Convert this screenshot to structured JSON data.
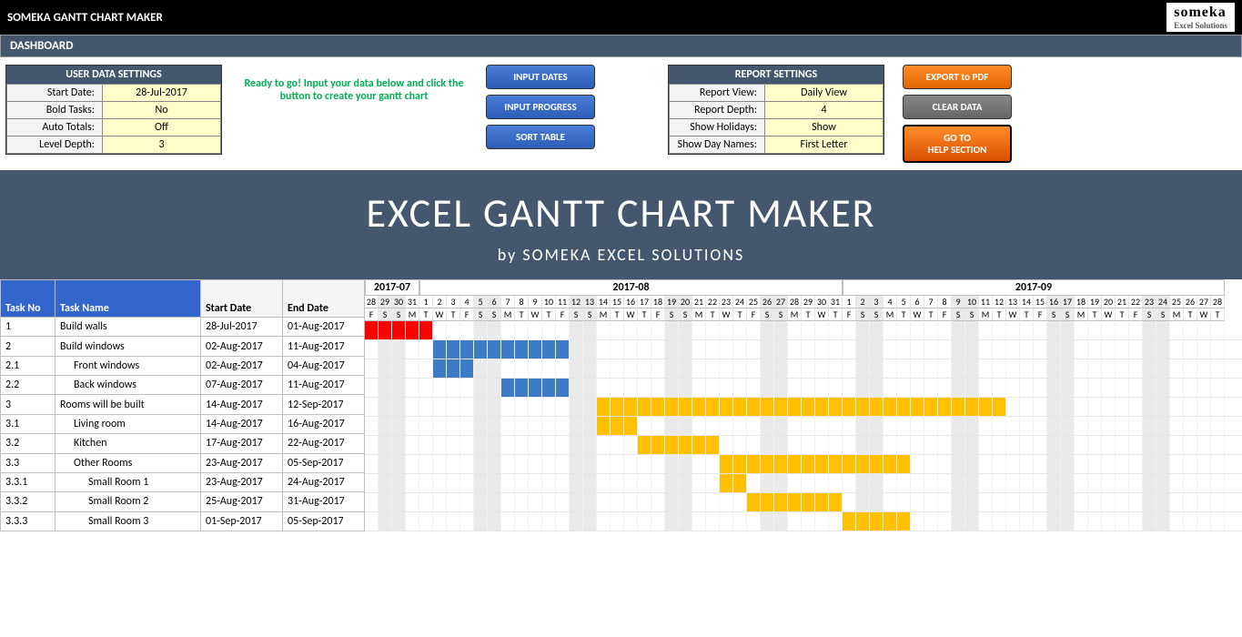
{
  "topbar": {
    "title": "SOMEKA GANTT CHART MAKER",
    "logo_main": "someka",
    "logo_sub": "Excel Solutions"
  },
  "dashboard": "DASHBOARD",
  "user_settings": {
    "header": "USER DATA SETTINGS",
    "rows": [
      {
        "label": "Start Date:",
        "value": "28-Jul-2017"
      },
      {
        "label": "Bold Tasks:",
        "value": "No"
      },
      {
        "label": "Auto Totals:",
        "value": "Off"
      },
      {
        "label": "Level Depth:",
        "value": "3"
      }
    ]
  },
  "ready_msg": "Ready to go! Input your data below and click the button to create your gantt chart",
  "action_buttons": [
    "INPUT DATES",
    "INPUT PROGRESS",
    "SORT TABLE"
  ],
  "report_settings": {
    "header": "REPORT SETTINGS",
    "rows": [
      {
        "label": "Report View:",
        "value": "Daily View"
      },
      {
        "label": "Report Depth:",
        "value": "4"
      },
      {
        "label": "Show Holidays:",
        "value": "Show"
      },
      {
        "label": "Show Day Names:",
        "value": "First Letter"
      }
    ]
  },
  "right_buttons": {
    "export": "EXPORT to PDF",
    "clear": "CLEAR DATA",
    "help1": "GO TO",
    "help2": "HELP SECTION"
  },
  "hero": {
    "title": "EXCEL GANTT CHART MAKER",
    "sub": "by SOMEKA EXCEL SOLUTIONS"
  },
  "table_headers": {
    "no": "Task No",
    "name": "Task Name",
    "start": "Start Date",
    "end": "End Date"
  },
  "months": [
    {
      "label": "2017-07",
      "days": 4
    },
    {
      "label": "2017-08",
      "days": 31
    },
    {
      "label": "2017-09",
      "days": 28
    }
  ],
  "timeline_start": "2017-07-28",
  "day_numbers": [
    28,
    29,
    30,
    31,
    1,
    2,
    3,
    4,
    5,
    6,
    7,
    8,
    9,
    10,
    11,
    12,
    13,
    14,
    15,
    16,
    17,
    18,
    19,
    20,
    21,
    22,
    23,
    24,
    25,
    26,
    27,
    28,
    29,
    30,
    31,
    1,
    2,
    3,
    4,
    5,
    6,
    7,
    8,
    9,
    10,
    11,
    12,
    13,
    14,
    15,
    16,
    17,
    18,
    19,
    20,
    21,
    22,
    23,
    24,
    25,
    26,
    27,
    28
  ],
  "day_names": [
    "F",
    "S",
    "S",
    "M",
    "T",
    "W",
    "T",
    "F",
    "S",
    "S",
    "M",
    "T",
    "W",
    "T",
    "F",
    "S",
    "S",
    "M",
    "T",
    "W",
    "T",
    "F",
    "S",
    "S",
    "M",
    "T",
    "W",
    "T",
    "F",
    "S",
    "S",
    "M",
    "T",
    "W",
    "T",
    "F",
    "S",
    "S",
    "M",
    "T",
    "W",
    "T",
    "F",
    "S",
    "S",
    "M",
    "T",
    "W",
    "T",
    "F",
    "S",
    "S",
    "M",
    "T",
    "W",
    "T",
    "F",
    "S",
    "S",
    "M",
    "T",
    "W",
    "T"
  ],
  "tasks": [
    {
      "no": "1",
      "name": "Build walls",
      "indent": 0,
      "start": "28-Jul-2017",
      "end": "01-Aug-2017",
      "bar_start": 0,
      "bar_len": 5,
      "color": "bar-red"
    },
    {
      "no": "2",
      "name": "Build windows",
      "indent": 0,
      "start": "02-Aug-2017",
      "end": "11-Aug-2017",
      "bar_start": 5,
      "bar_len": 10,
      "color": "bar-blue"
    },
    {
      "no": "2.1",
      "name": "Front windows",
      "indent": 1,
      "start": "02-Aug-2017",
      "end": "04-Aug-2017",
      "bar_start": 5,
      "bar_len": 3,
      "color": "bar-blue"
    },
    {
      "no": "2.2",
      "name": "Back windows",
      "indent": 1,
      "start": "07-Aug-2017",
      "end": "11-Aug-2017",
      "bar_start": 10,
      "bar_len": 5,
      "color": "bar-blue"
    },
    {
      "no": "3",
      "name": "Rooms will be built",
      "indent": 0,
      "start": "14-Aug-2017",
      "end": "12-Sep-2017",
      "bar_start": 17,
      "bar_len": 30,
      "color": "bar-yellow"
    },
    {
      "no": "3.1",
      "name": "Living room",
      "indent": 1,
      "start": "14-Aug-2017",
      "end": "16-Aug-2017",
      "bar_start": 17,
      "bar_len": 3,
      "color": "bar-yellow"
    },
    {
      "no": "3.2",
      "name": "Kitchen",
      "indent": 1,
      "start": "17-Aug-2017",
      "end": "22-Aug-2017",
      "bar_start": 20,
      "bar_len": 6,
      "color": "bar-yellow"
    },
    {
      "no": "3.3",
      "name": "Other Rooms",
      "indent": 1,
      "start": "23-Aug-2017",
      "end": "05-Sep-2017",
      "bar_start": 26,
      "bar_len": 14,
      "color": "bar-yellow"
    },
    {
      "no": "3.3.1",
      "name": "Small Room 1",
      "indent": 2,
      "start": "23-Aug-2017",
      "end": "24-Aug-2017",
      "bar_start": 26,
      "bar_len": 2,
      "color": "bar-yellow"
    },
    {
      "no": "3.3.2",
      "name": "Small Room 2",
      "indent": 2,
      "start": "25-Aug-2017",
      "end": "31-Aug-2017",
      "bar_start": 28,
      "bar_len": 7,
      "color": "bar-yellow"
    },
    {
      "no": "3.3.3",
      "name": "Small Room 3",
      "indent": 2,
      "start": "01-Sep-2017",
      "end": "05-Sep-2017",
      "bar_start": 35,
      "bar_len": 5,
      "color": "bar-yellow"
    }
  ]
}
